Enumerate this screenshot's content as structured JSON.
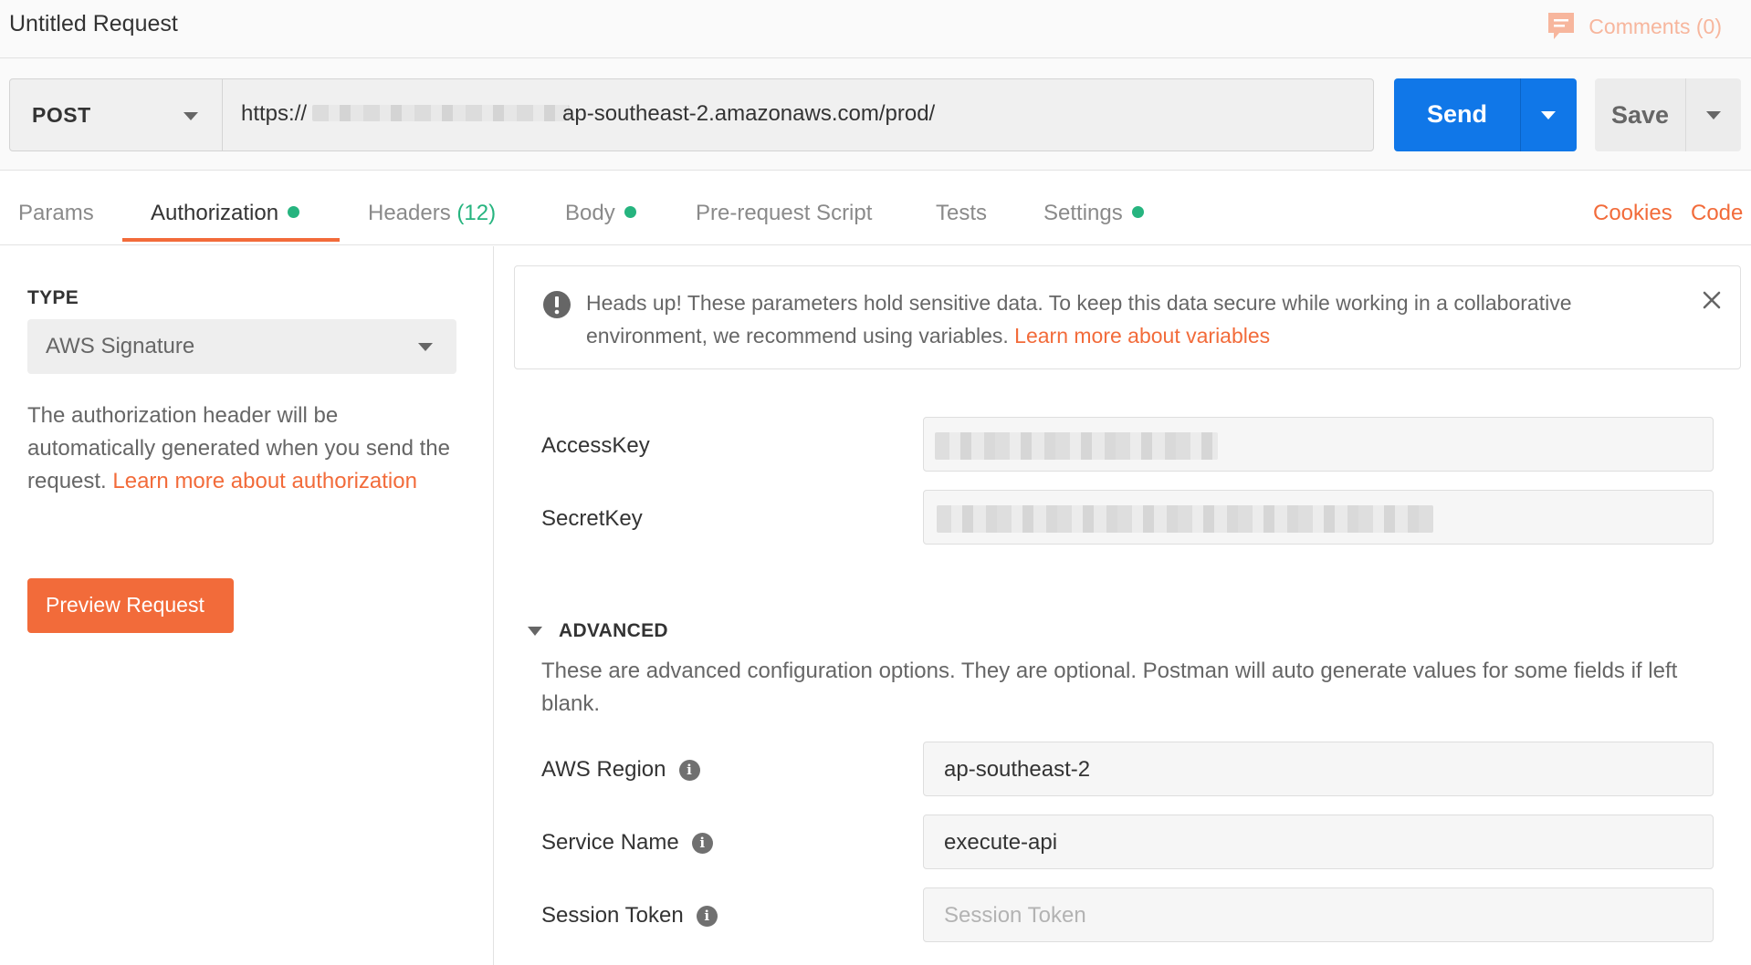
{
  "window": {
    "title": "Untitled Request",
    "comments_label": "Comments (0)"
  },
  "request": {
    "method": "POST",
    "url_prefix": "https://",
    "url_suffix": "ap-southeast-2.amazonaws.com/prod/",
    "send_label": "Send",
    "save_label": "Save"
  },
  "tabs": [
    {
      "label": "Params",
      "dot": false
    },
    {
      "label": "Authorization",
      "dot": true,
      "active": true
    },
    {
      "label": "Headers",
      "count": "(12)"
    },
    {
      "label": "Body",
      "dot": true
    },
    {
      "label": "Pre-request Script"
    },
    {
      "label": "Tests"
    },
    {
      "label": "Settings",
      "dot": true
    }
  ],
  "links": {
    "cookies": "Cookies",
    "code": "Code"
  },
  "auth": {
    "type_label": "TYPE",
    "type_value": "AWS Signature",
    "description": "The authorization header will be automatically generated when you send the request. ",
    "learn_more": "Learn more about authorization",
    "preview_button": "Preview Request"
  },
  "notice": {
    "text": "Heads up! These parameters hold sensitive data. To keep this data secure while working in a collaborative environment, we recommend using variables. ",
    "link": "Learn more about variables"
  },
  "fields": {
    "access_key": {
      "label": "AccessKey"
    },
    "secret_key": {
      "label": "SecretKey"
    }
  },
  "advanced": {
    "heading": "ADVANCED",
    "description": "These are advanced configuration options. They are optional. Postman will auto generate values for some fields if left blank.",
    "aws_region": {
      "label": "AWS Region",
      "value": "ap-southeast-2"
    },
    "service_name": {
      "label": "Service Name",
      "value": "execute-api"
    },
    "session_token": {
      "label": "Session Token",
      "placeholder": "Session Token"
    }
  },
  "colors": {
    "accent": "#f26b3a",
    "primary": "#1077e8",
    "success": "#26b47f"
  }
}
